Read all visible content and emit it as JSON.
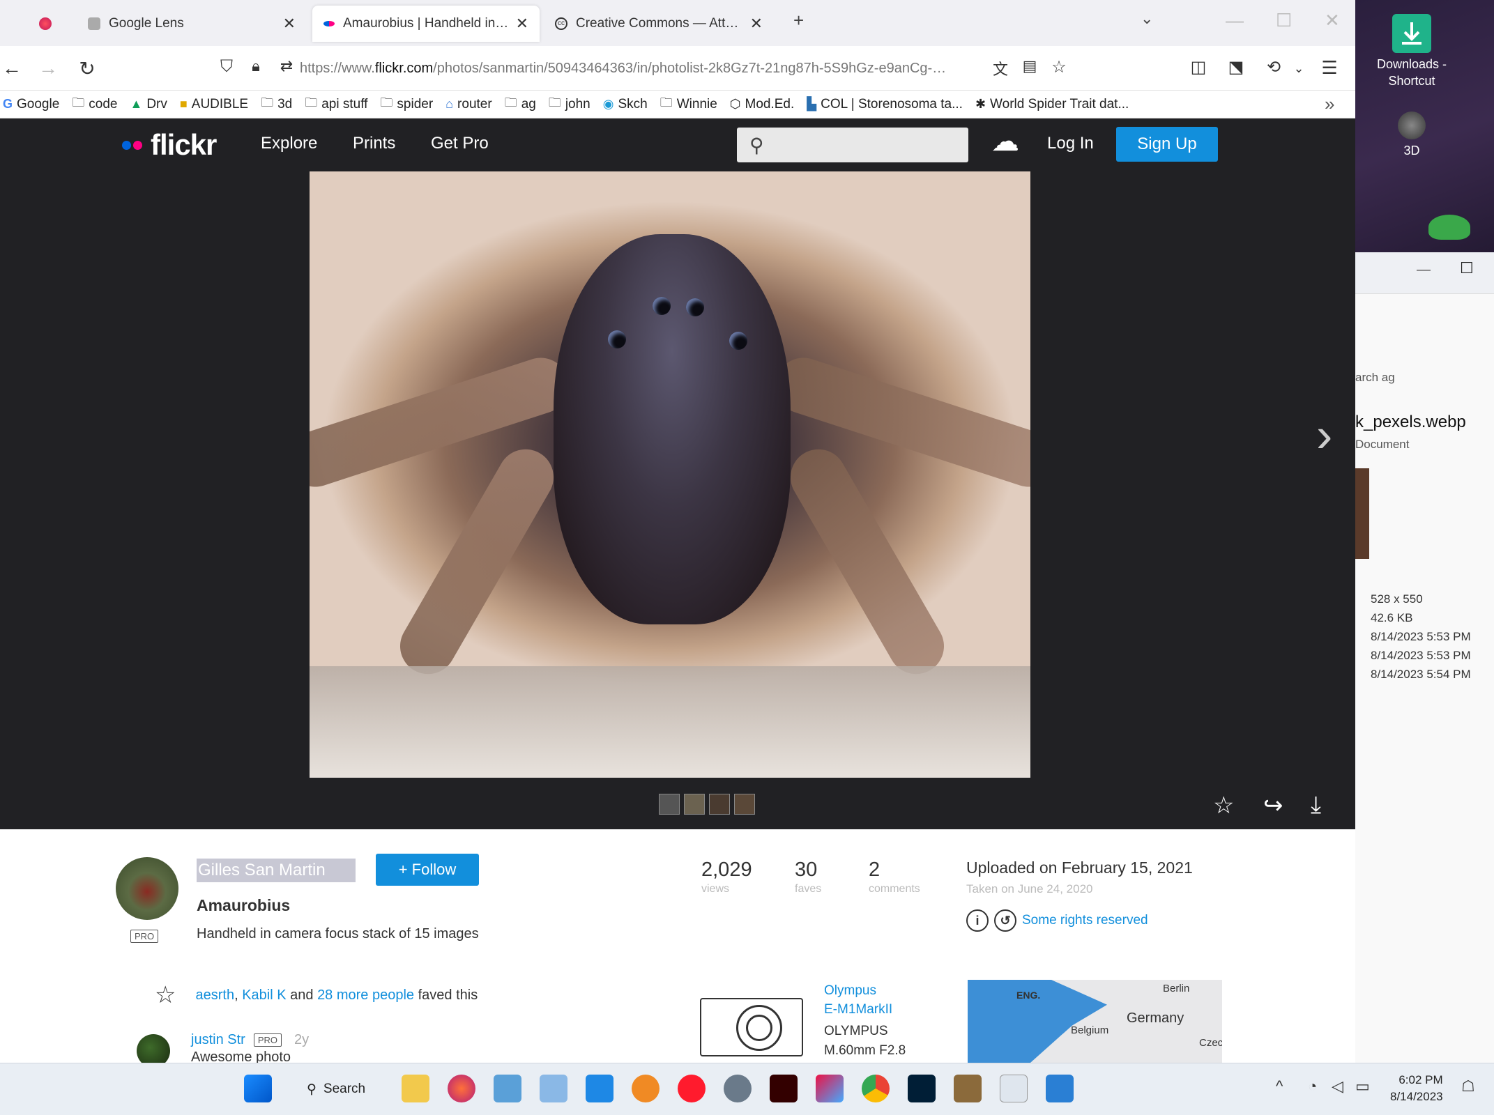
{
  "browser": {
    "tabs": [
      {
        "title": "",
        "favicon": "firefox-icon"
      },
      {
        "title": "Google Lens",
        "favicon": "google-lens-icon"
      },
      {
        "title": "Amaurobius | Handheld in ca…",
        "favicon": "flickr-icon"
      },
      {
        "title": "Creative Commons — Attribu…",
        "favicon": "cc-icon"
      }
    ],
    "url_prefix": "https://www.",
    "url_domain": "flickr.com",
    "url_rest": "/photos/sanmartin/50943464363/in/photolist-2k8Gz7t-21ng87h-5S9hGz-e9anCg-…",
    "bookmarks": [
      "Google",
      "code",
      "Drv",
      "AUDIBLE",
      "3d",
      "api stuff",
      "spider",
      "router",
      "ag",
      "john",
      "Skch",
      "Winnie",
      "Mod.Ed.",
      "COL | Storenosoma ta...",
      "World Spider Trait dat..."
    ]
  },
  "flickr": {
    "logo": "flickr",
    "nav": [
      "Explore",
      "Prints",
      "Get Pro"
    ],
    "login": "Log In",
    "signup": "Sign Up",
    "owner": "Gilles San Martin",
    "pro_badge": "PRO",
    "follow": "+ Follow",
    "photo_title": "Amaurobius",
    "photo_desc": "Handheld in camera focus stack of 15 images",
    "stats": [
      {
        "num": "2,029",
        "label": "views"
      },
      {
        "num": "30",
        "label": "faves"
      },
      {
        "num": "2",
        "label": "comments"
      }
    ],
    "uploaded": "Uploaded on February 15, 2021",
    "taken": "Taken on June 24, 2020",
    "rights": "Some rights reserved",
    "faves_user1": "aesrth",
    "faves_sep": ", ",
    "faves_user2": "Kabil K",
    "faves_and": " and ",
    "faves_more": "28 more people",
    "faves_tail": " faved this",
    "comment_user": "justin Str",
    "comment_age": "2y",
    "comment_text": "Awesome photo",
    "camera_make": "Olympus",
    "camera_model": "E-M1MarkII",
    "lens_make": "OLYMPUS",
    "lens_model": "M.60mm F2.8",
    "map_labels": [
      "ENG.",
      "Berlin",
      "Germany",
      "Belgium",
      "Czec"
    ]
  },
  "desktop": {
    "icon1": "Downloads - Shortcut",
    "icon2": "3D"
  },
  "explorer": {
    "search_hint": "arch ag",
    "file_name": "k_pexels.webp",
    "file_type": "Document",
    "dimensions": "528 x 550",
    "size": "42.6 KB",
    "date1": "8/14/2023 5:53 PM",
    "date2": "8/14/2023 5:53 PM",
    "date3": "8/14/2023 5:54 PM"
  },
  "taskbar": {
    "search": "Search",
    "time": "6:02 PM",
    "date": "8/14/2023"
  },
  "colors": {
    "flickr_blue": "#128fdc",
    "flickr_dark": "#212124",
    "flickr_pink": "#ff0084"
  }
}
